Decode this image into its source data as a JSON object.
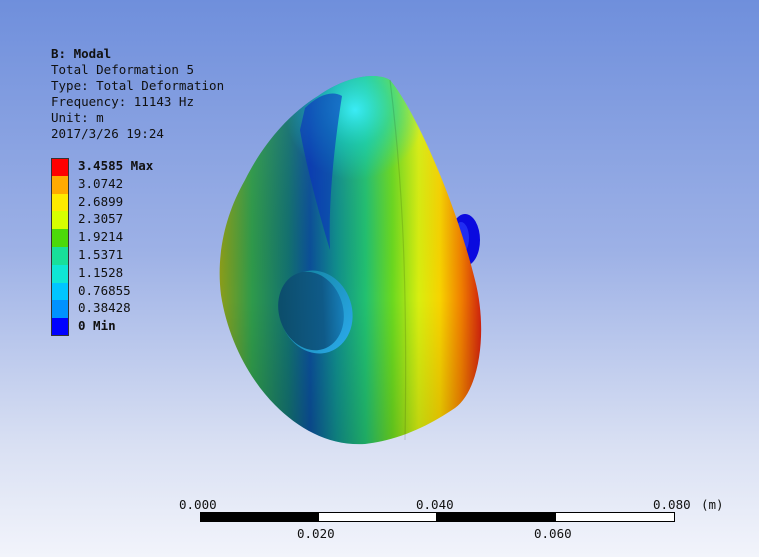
{
  "info": {
    "title": "B: Modal",
    "result": "Total Deformation 5",
    "type": "Type: Total Deformation",
    "frequency": "Frequency: 11143 Hz",
    "unit": "Unit: m",
    "timestamp": "2017/3/26 19:24"
  },
  "legend": {
    "items": [
      {
        "label": "3.4585 Max",
        "color": "#ff0000",
        "bold": true
      },
      {
        "label": "3.0742",
        "color": "#ffaa00",
        "bold": false
      },
      {
        "label": "2.6899",
        "color": "#ffea00",
        "bold": false
      },
      {
        "label": "2.3057",
        "color": "#d8ff00",
        "bold": false
      },
      {
        "label": "1.9214",
        "color": "#4cd90a",
        "bold": false
      },
      {
        "label": "1.5371",
        "color": "#18df9a",
        "bold": false
      },
      {
        "label": "1.1528",
        "color": "#0fe6d4",
        "bold": false
      },
      {
        "label": "0.76855",
        "color": "#00c5ff",
        "bold": false
      },
      {
        "label": "0.38428",
        "color": "#0092ff",
        "bold": false
      },
      {
        "label": "0 Min",
        "color": "#0000ff",
        "bold": true
      }
    ]
  },
  "scale_bar": {
    "top_labels": [
      "0.000",
      "0.040",
      "0.080"
    ],
    "bottom_labels": [
      "0.020",
      "0.060"
    ],
    "unit": "(m)"
  }
}
